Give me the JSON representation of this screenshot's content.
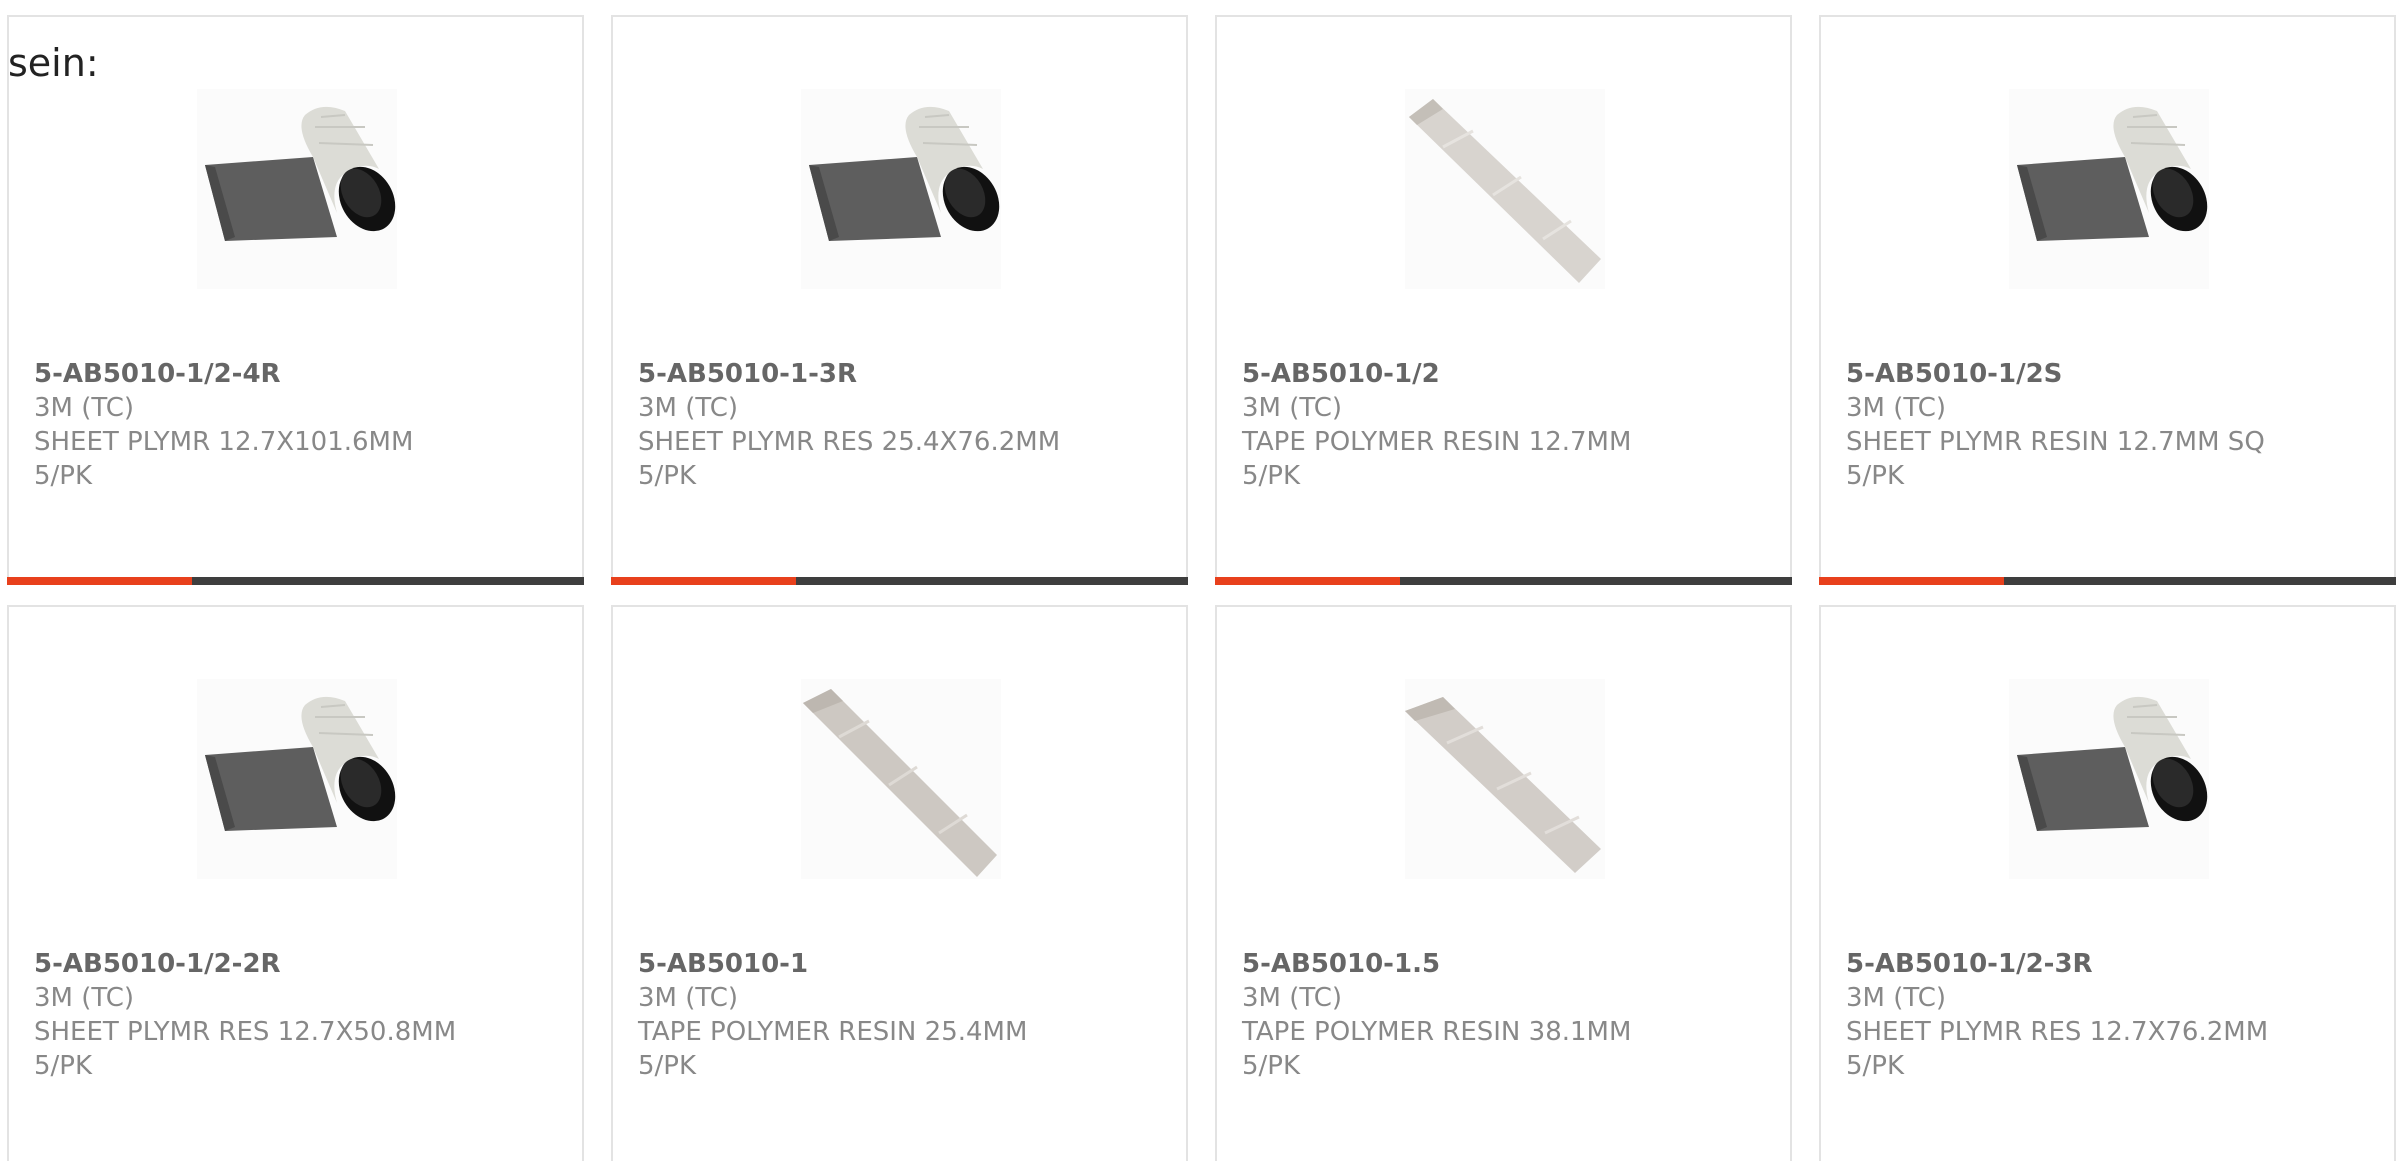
{
  "intro_text": "sein:",
  "accent_color": "#e8401c",
  "track_color": "#3e3e3e",
  "products": [
    {
      "part": "5-AB5010-1/2-4R",
      "brand": "3M (TC)",
      "description": "SHEET PLYMR 12.7X101.6MM",
      "pack": "5/PK",
      "image": "sheet-roll-image",
      "progress": 0.32
    },
    {
      "part": "5-AB5010-1-3R",
      "brand": "3M (TC)",
      "description": "SHEET PLYMR RES 25.4X76.2MM",
      "pack": "5/PK",
      "image": "sheet-roll-image",
      "progress": 0.32
    },
    {
      "part": "5-AB5010-1/2",
      "brand": "3M (TC)",
      "description": "TAPE POLYMER RESIN 12.7MM",
      "pack": "5/PK",
      "image": "tape-strip-image",
      "progress": 0.32
    },
    {
      "part": "5-AB5010-1/2S",
      "brand": "3M (TC)",
      "description": "SHEET PLYMR RESIN 12.7MM SQ",
      "pack": "5/PK",
      "image": "sheet-roll-image",
      "progress": 0.32
    },
    {
      "part": "5-AB5010-1/2-2R",
      "brand": "3M (TC)",
      "description": "SHEET PLYMR RES 12.7X50.8MM",
      "pack": "5/PK",
      "image": "sheet-roll-image"
    },
    {
      "part": "5-AB5010-1",
      "brand": "3M (TC)",
      "description": "TAPE POLYMER RESIN 25.4MM",
      "pack": "5/PK",
      "image": "tape-strip-image"
    },
    {
      "part": "5-AB5010-1.5",
      "brand": "3M (TC)",
      "description": "TAPE POLYMER RESIN 38.1MM",
      "pack": "5/PK",
      "image": "tape-strip-image"
    },
    {
      "part": "5-AB5010-1/2-3R",
      "brand": "3M (TC)",
      "description": "SHEET PLYMR RES 12.7X76.2MM",
      "pack": "5/PK",
      "image": "sheet-roll-image"
    }
  ]
}
